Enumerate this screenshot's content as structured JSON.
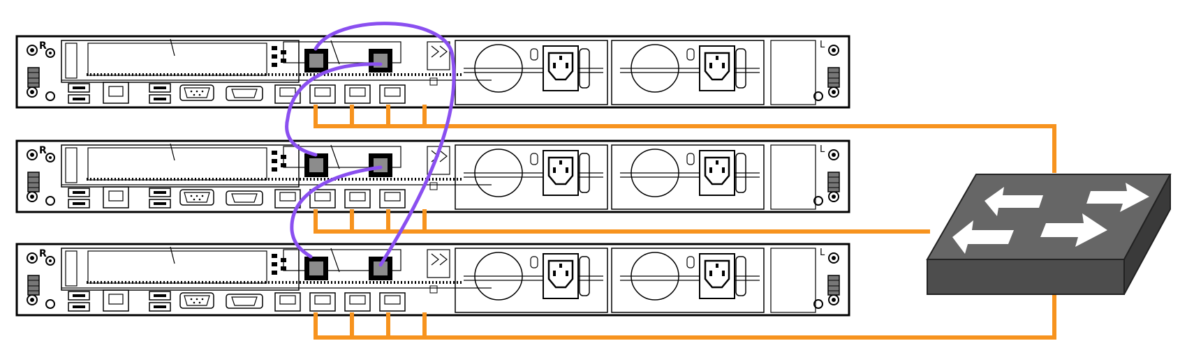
{
  "servers": [
    {
      "id": "server-1",
      "left_label": "R",
      "right_label": "L"
    },
    {
      "id": "server-2",
      "left_label": "R",
      "right_label": "L"
    },
    {
      "id": "server-3",
      "left_label": "R",
      "right_label": "L"
    }
  ],
  "colors": {
    "ethernet_cable": "#F7931E",
    "interconnect_cable": "#8A4FF0",
    "switch_top": "#666666",
    "switch_front": "#4D4D4D",
    "switch_side": "#3A3A3A",
    "arrow": "#FFFFFF",
    "server_line": "#000000",
    "sfp_port": "#8C8C8C"
  },
  "switch": {
    "icon": "network-switch-icon",
    "arrow_count": 4
  },
  "cabling": {
    "ethernet_ports_per_server": 4,
    "sfp_ports_per_server": 2
  }
}
